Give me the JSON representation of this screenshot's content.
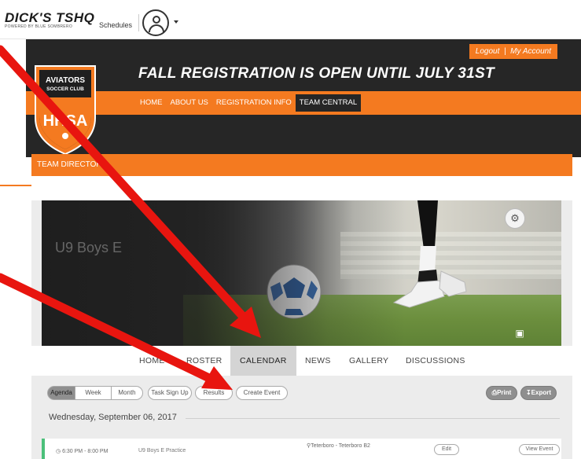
{
  "topbar": {
    "brand_name": "DICK'S TSHQ",
    "brand_sub": "POWERED BY BLUE SOMBRERO",
    "schedules": "Schedules"
  },
  "header": {
    "account_links": [
      "Logout",
      "My Account"
    ],
    "account_sep": "|",
    "banner": "FALL REGISTRATION IS OPEN UNTIL JULY 31ST",
    "nav": [
      "HOME",
      "ABOUT US",
      "REGISTRATION INFO",
      "TEAM CENTRAL"
    ],
    "nav_active": "TEAM CENTRAL",
    "logo": {
      "line1": "AVIATORS",
      "line2": "SOCCER CLUB",
      "monogram": "HHSA"
    }
  },
  "directory": {
    "title": "TEAM DIRECTORY"
  },
  "team": {
    "name": "U9 Boys E"
  },
  "tabs": [
    "HOME",
    "ROSTER",
    "CALENDAR",
    "NEWS",
    "GALLERY",
    "DISCUSSIONS"
  ],
  "active_tab": "CALENDAR",
  "toolbar": {
    "views": [
      "Agenda",
      "Week",
      "Month"
    ],
    "active_view": "Agenda",
    "task_signup": "Task Sign Up",
    "results": "Results",
    "create_event": "Create Event",
    "print": "Print",
    "export": "Export"
  },
  "date_header": "Wednesday, September 06, 2017",
  "event": {
    "time": "6:30 PM - 8:00 PM",
    "title": "U9 Boys E Practice",
    "location": "Teterboro - Teterboro B2",
    "edit": "Edit",
    "view": "View Event"
  },
  "colors": {
    "accent": "#f47a20",
    "header_bg": "#262626",
    "arrow": "#e8150f",
    "event_stripe": "#4bc07a"
  }
}
